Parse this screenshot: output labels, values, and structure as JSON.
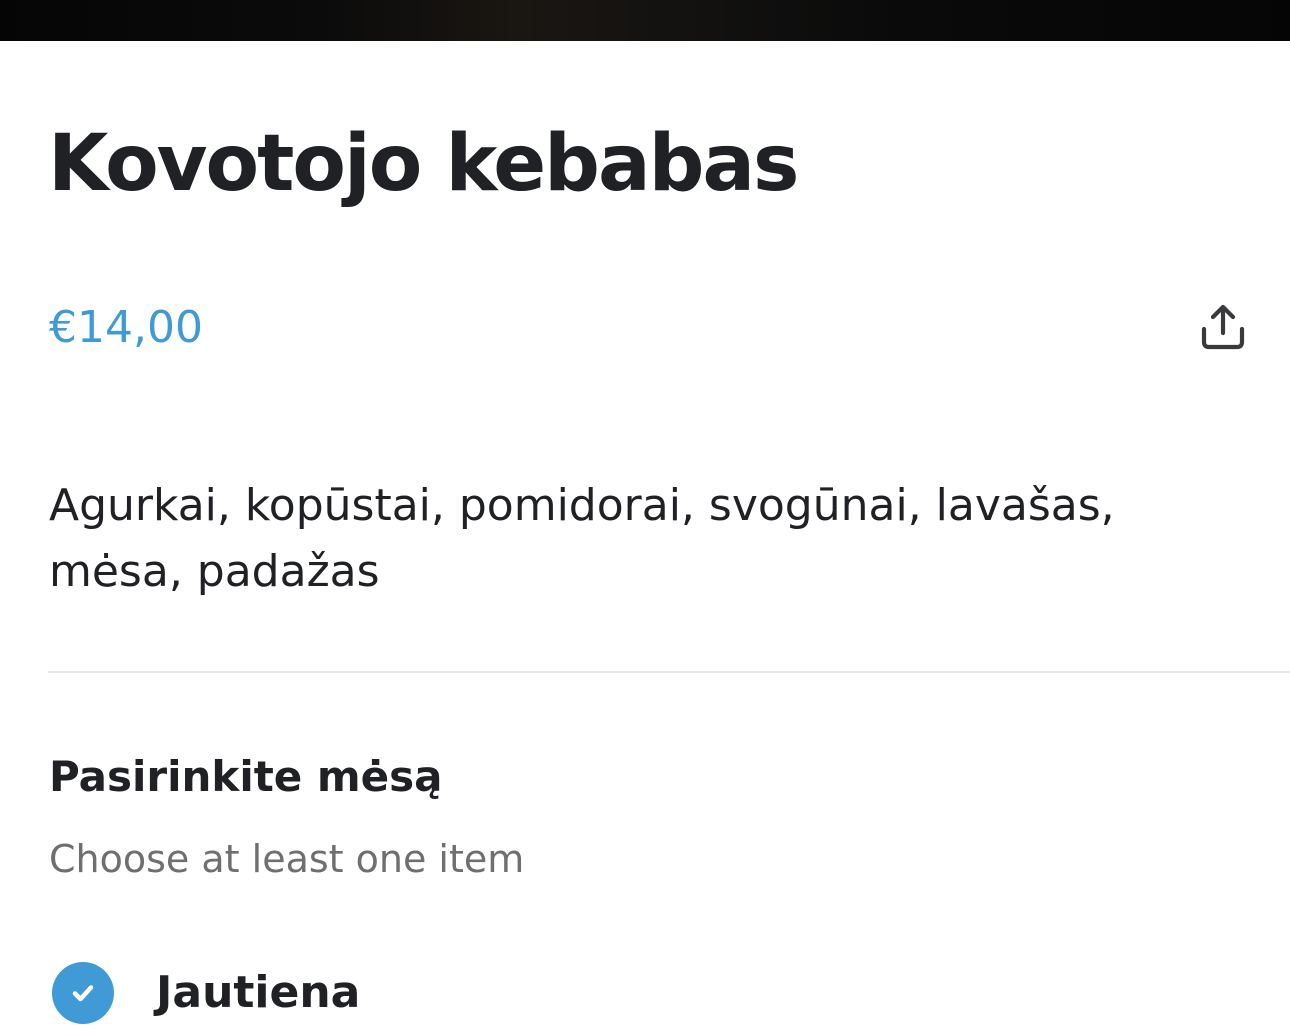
{
  "product": {
    "title": "Kovotojo kebabas",
    "price": "€14,00",
    "description": "Agurkai, kopūstai, pomidorai, svogūnai, lavašas, mėsa, padažas"
  },
  "actions": {
    "share_icon": "share-icon"
  },
  "options_group": {
    "title": "Pasirinkite mėsą",
    "hint": "Choose at least one item",
    "items": [
      {
        "label": "Jautiena",
        "selected": true
      }
    ]
  },
  "colors": {
    "accent": "#3f9ad6",
    "text": "#202125",
    "muted": "#6f6f6f",
    "divider": "#e4e4e4"
  }
}
